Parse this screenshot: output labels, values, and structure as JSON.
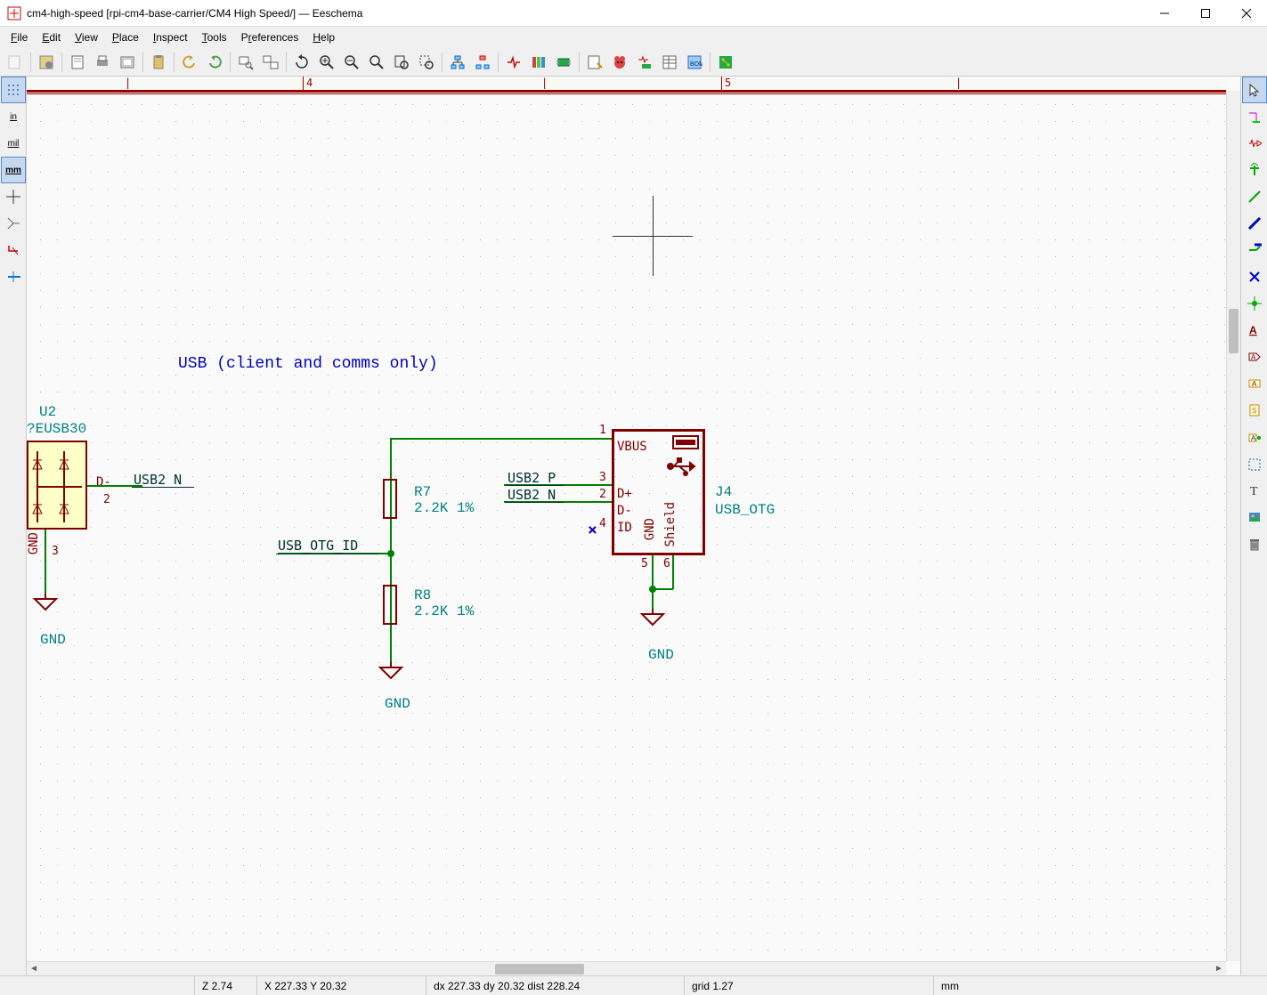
{
  "window": {
    "title": "cm4-high-speed [rpi-cm4-base-carrier/CM4 High Speed/] — Eeschema"
  },
  "menu": {
    "file": "File",
    "edit": "Edit",
    "view": "View",
    "place": "Place",
    "inspect": "Inspect",
    "tools": "Tools",
    "preferences": "Preferences",
    "help": "Help"
  },
  "left_tools": {
    "in": "in",
    "mil": "mil",
    "mm": "mm"
  },
  "ruler": {
    "tick4": "4",
    "tick5": "5"
  },
  "schematic": {
    "title_comment": "USB (client and comms only)",
    "u2_ref": "U2",
    "u2_val": "?EUSB30",
    "u2_pin_d_minus": "D-",
    "u2_pin2": "2",
    "u2_pin3": "3",
    "u2_gnd_text": "GND",
    "net_usb2_n": "USB2_N",
    "net_usb2_p": "USB2_P",
    "net_usb2_n2": "USB2_N",
    "net_usb_otg_id": "USB_OTG_ID",
    "r7_ref": "R7",
    "r7_val": "2.2K 1%",
    "r8_ref": "R8",
    "r8_val": "2.2K 1%",
    "gnd1": "GND",
    "gnd2": "GND",
    "gnd3": "GND",
    "j4_ref": "J4",
    "j4_val": "USB_OTG",
    "j4_vbus": "VBUS",
    "j4_dplus": "D+",
    "j4_dminus": "D-",
    "j4_id": "ID",
    "j4_gnd": "GND",
    "j4_shield": "Shield",
    "pin1": "1",
    "pin2": "2",
    "pin3": "3",
    "pin4": "4",
    "pin5": "5",
    "pin6": "6"
  },
  "status": {
    "z": "Z 2.74",
    "xy": "X 227.33  Y 20.32",
    "dxy": "dx 227.33  dy 20.32  dist 228.24",
    "grid": "grid 1.27",
    "unit": "mm"
  }
}
